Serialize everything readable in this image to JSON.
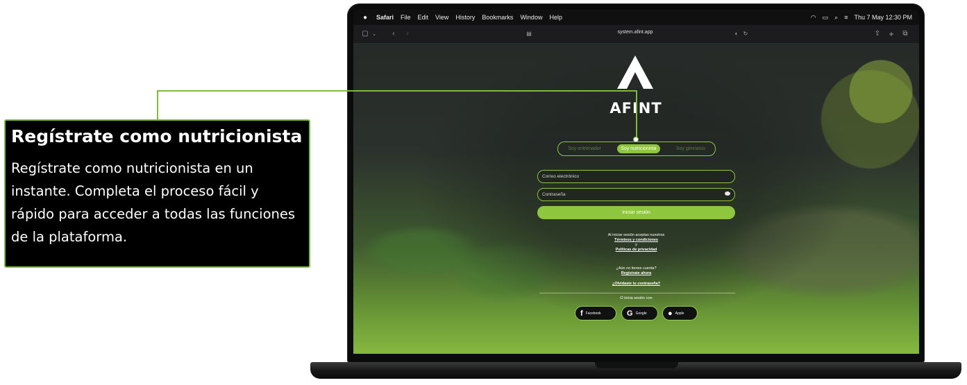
{
  "callout": {
    "title": "Regístrate como nutricionista",
    "body": "Regístrate como nutricionista en un instante. Completa el proceso fácil y rápido para acceder a todas las funciones de la plataforma."
  },
  "menubar": {
    "app": "Safari",
    "items": [
      "File",
      "Edit",
      "View",
      "History",
      "Bookmarks",
      "Window",
      "Help"
    ],
    "clock": "Thu 7 May 12:30 PM"
  },
  "browser": {
    "url": "system.afint.app"
  },
  "page": {
    "brand": "AFINT",
    "roles": [
      "Soy entrenador",
      "Soy nutricionista",
      "Soy gimnasio"
    ],
    "active_role": "Soy nutricionista",
    "email_placeholder": "Correo electrónico",
    "password_placeholder": "Contraseña",
    "login_button": "Iniciar sesión",
    "terms_intro": "Al iniciar sesión aceptas nuestros",
    "terms_link": "Términos y condiciones",
    "and": "y",
    "privacy_link": "Políticas de privacidad",
    "no_account": "¿Aún no tienes cuenta?",
    "register_link": "Regístrate ahora",
    "forgot_link": "¿Olvidaste tu contraseña?",
    "social_intro": "O inicia sesión con",
    "social": [
      "Facebook",
      "Google",
      "Apple"
    ]
  },
  "colors": {
    "accent": "#8ec63f",
    "callout_border": "#7dba3e"
  }
}
